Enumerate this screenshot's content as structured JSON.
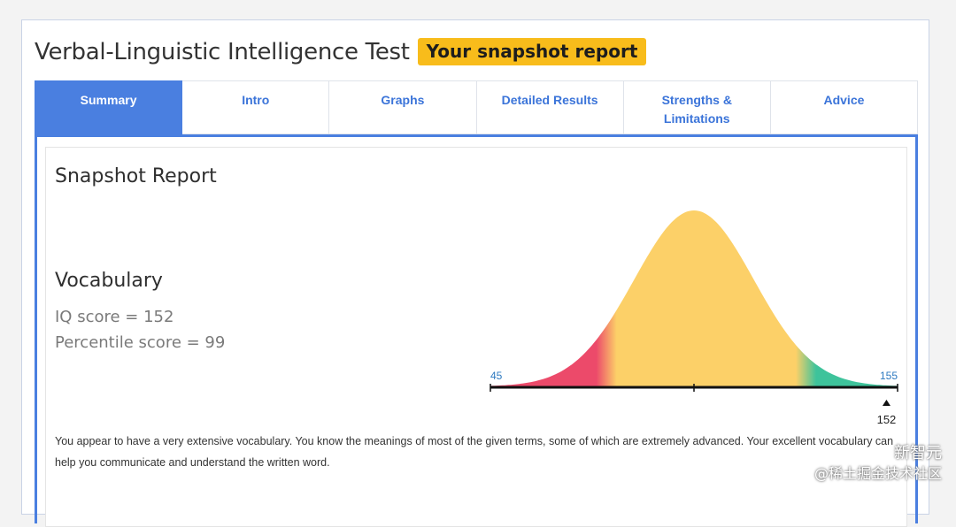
{
  "header": {
    "title": "Verbal-Linguistic Intelligence Test",
    "badge": "Your snapshot report"
  },
  "tabs": [
    {
      "label": "Summary",
      "active": true
    },
    {
      "label": "Intro",
      "active": false
    },
    {
      "label": "Graphs",
      "active": false
    },
    {
      "label": "Detailed Results",
      "active": false
    },
    {
      "label": "Strengths & Limitations",
      "active": false
    },
    {
      "label": "Advice",
      "active": false
    }
  ],
  "report": {
    "title": "Snapshot Report",
    "section": "Vocabulary",
    "iq_line": "IQ score = 152",
    "percentile_line": "Percentile score = 99",
    "description": "You appear to have a very extensive vocabulary. You know the meanings of most of the given terms, some of which are extremely advanced. Your excellent vocabulary can help you communicate and understand the written word."
  },
  "chart_data": {
    "type": "area",
    "xlim": [
      45,
      155
    ],
    "min_label": "45",
    "max_label": "155",
    "marker_value": 152,
    "marker_label": "152",
    "colors": {
      "low": "#ec4a6a",
      "mid": "#fcd068",
      "high": "#3ec39b",
      "axis": "#111111",
      "tick_label": "#2d79c0"
    }
  },
  "watermark": {
    "line1": "新智元",
    "line2": "@稀土掘金技术社区"
  }
}
